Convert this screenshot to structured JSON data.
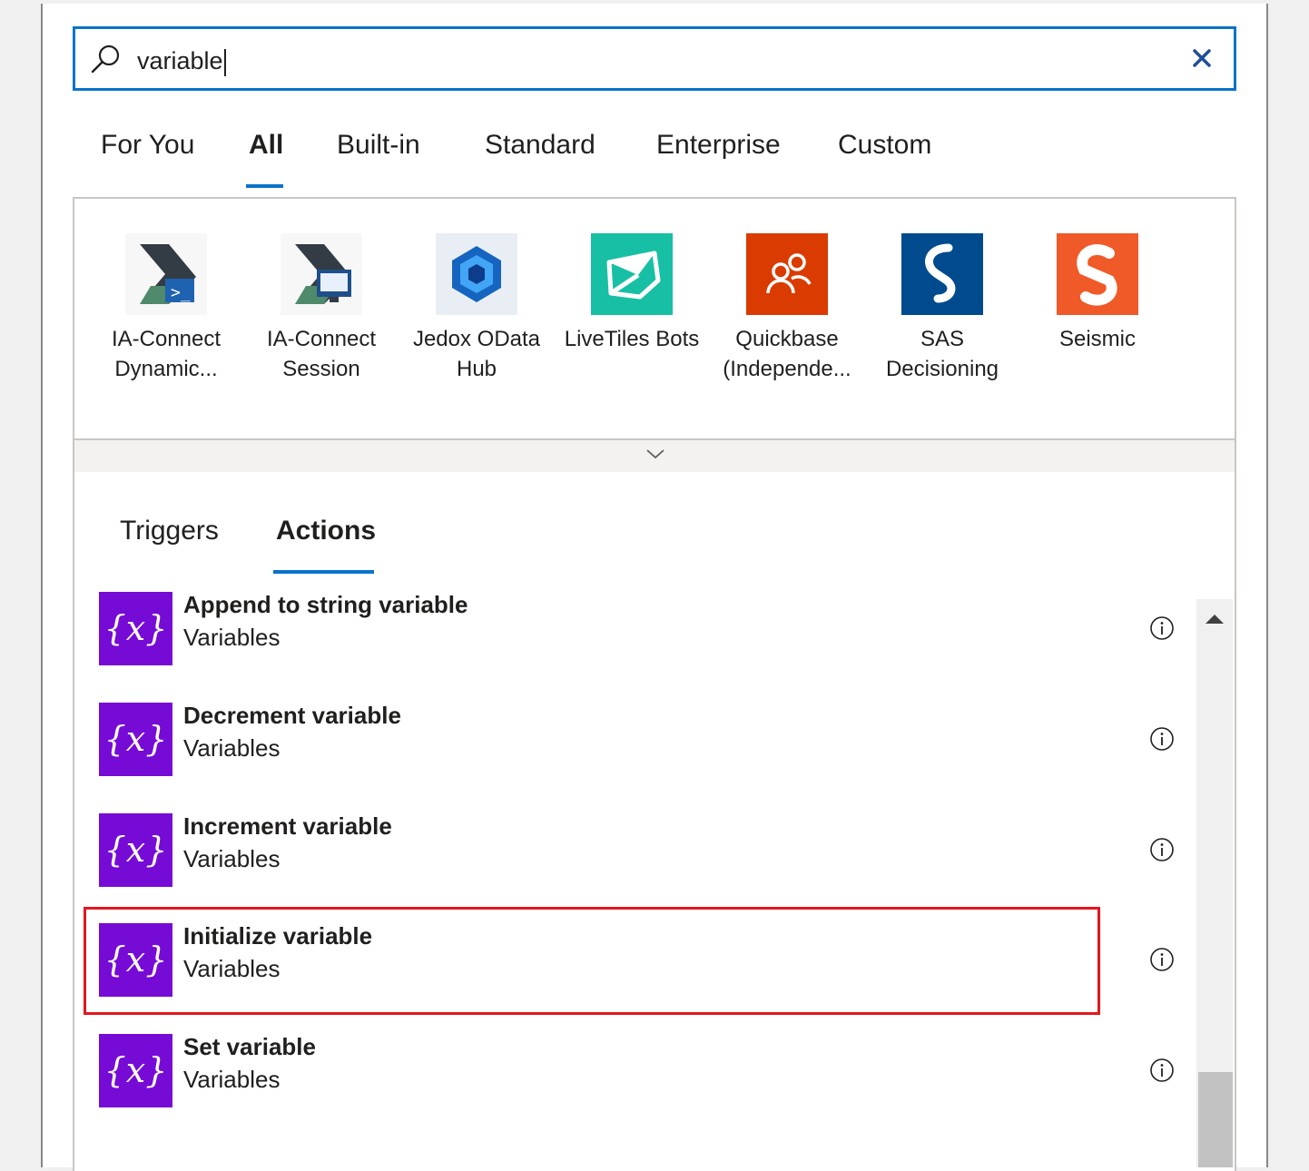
{
  "search": {
    "value": "variable",
    "icon": "search-icon",
    "clear_icon": "close-icon"
  },
  "category_tabs": [
    {
      "label": "For You"
    },
    {
      "label": "All",
      "active": true
    },
    {
      "label": "Built-in"
    },
    {
      "label": "Standard"
    },
    {
      "label": "Enterprise"
    },
    {
      "label": "Custom"
    }
  ],
  "connectors": [
    {
      "line1": "IA-Connect",
      "line2": "Dynamic...",
      "icon": "ia-connect-dynamic-icon"
    },
    {
      "line1": "IA-Connect",
      "line2": "Session",
      "icon": "ia-connect-session-icon"
    },
    {
      "line1": "Jedox OData",
      "line2": "Hub",
      "icon": "jedox-odata-icon",
      "color": "#1565c0"
    },
    {
      "line1": "LiveTiles Bots",
      "line2": "",
      "icon": "livetiles-icon",
      "color": "#17c0a4"
    },
    {
      "line1": "Quickbase",
      "line2": "(Independe...",
      "icon": "quickbase-icon",
      "color": "#da3b01"
    },
    {
      "line1": "SAS",
      "line2": "Decisioning",
      "icon": "sas-icon",
      "color": "#004b8d"
    },
    {
      "line1": "Seismic",
      "line2": "",
      "icon": "seismic-icon",
      "color": "#f05a28"
    }
  ],
  "sub_tabs": [
    {
      "label": "Triggers"
    },
    {
      "label": "Actions",
      "active": true
    }
  ],
  "actions": [
    {
      "title": "Append to string variable",
      "subtitle": "Variables",
      "icon_glyph": "{x}"
    },
    {
      "title": "Decrement variable",
      "subtitle": "Variables",
      "icon_glyph": "{x}"
    },
    {
      "title": "Increment variable",
      "subtitle": "Variables",
      "icon_glyph": "{x}"
    },
    {
      "title": "Initialize variable",
      "subtitle": "Variables",
      "icon_glyph": "{x}",
      "highlighted": true
    },
    {
      "title": "Set variable",
      "subtitle": "Variables",
      "icon_glyph": "{x}"
    }
  ],
  "colors": {
    "accent": "#0a73c9",
    "variables_purple": "#770bd6",
    "highlight_red": "#e3161f"
  }
}
